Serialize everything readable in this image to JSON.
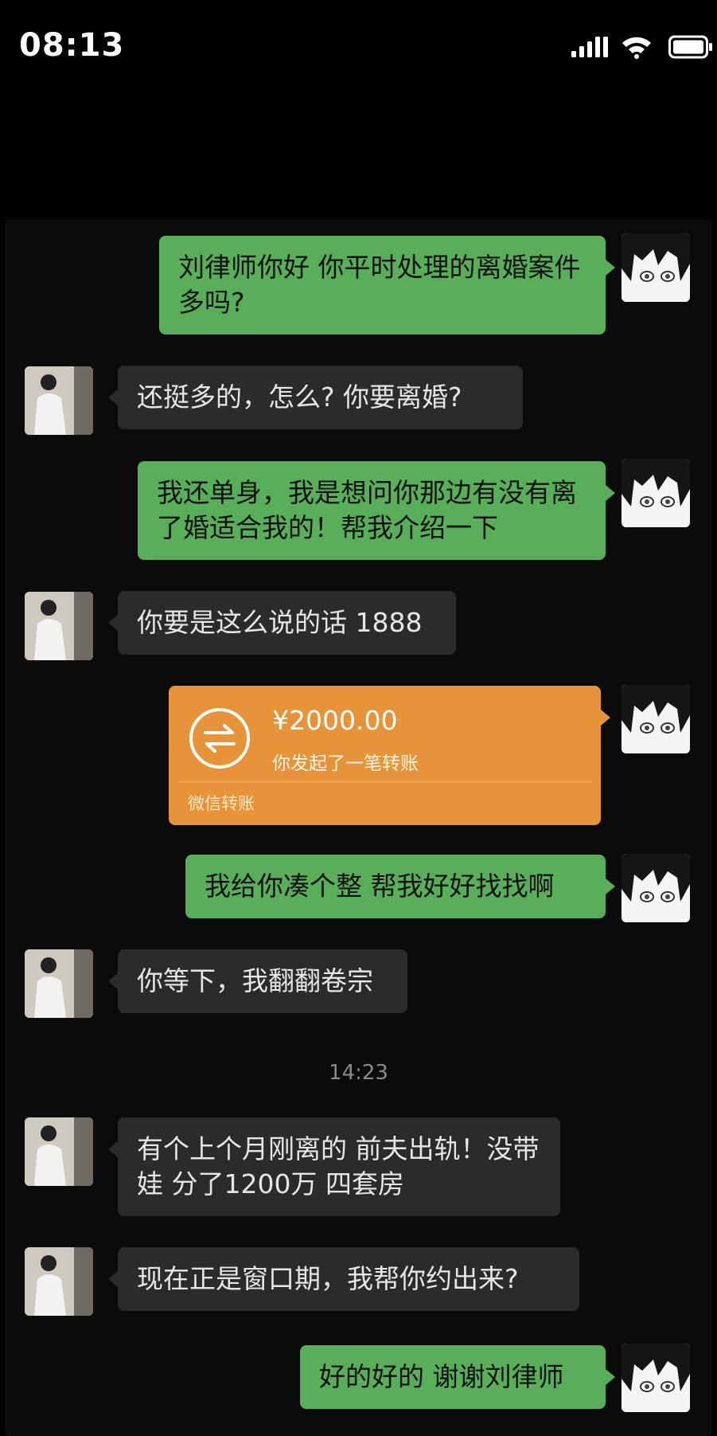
{
  "status_bar": {
    "time": "08:13"
  },
  "messages": [
    {
      "side": "me",
      "text": "刘律师你好 你平时处理的离婚案件多吗?"
    },
    {
      "side": "them",
      "text": "还挺多的，怎么? 你要离婚?"
    },
    {
      "side": "me",
      "text": "我还单身，我是想问你那边有没有离了婚适合我的！帮我介绍一下"
    },
    {
      "side": "them",
      "text": "你要是这么说的话 1888"
    },
    {
      "side": "me",
      "type": "transfer",
      "amount": "¥2000.00",
      "desc": "你发起了一笔转账",
      "brand": "微信转账"
    },
    {
      "side": "me",
      "text": "我给你凑个整 帮我好好找找啊"
    },
    {
      "side": "them",
      "text": "你等下，我翻翻卷宗"
    },
    {
      "side": "them",
      "text": "有个上个月刚离的 前夫出轨！没带娃 分了1200万 四套房"
    },
    {
      "side": "them",
      "text": "现在正是窗口期，我帮你约出来?"
    },
    {
      "side": "me",
      "text": "好的好的 谢谢刘律师"
    }
  ],
  "timestamp": "14:23",
  "colors": {
    "my_bubble": "#59ae5a",
    "their_bubble": "#2b2b2b",
    "transfer": "#e6933a"
  }
}
